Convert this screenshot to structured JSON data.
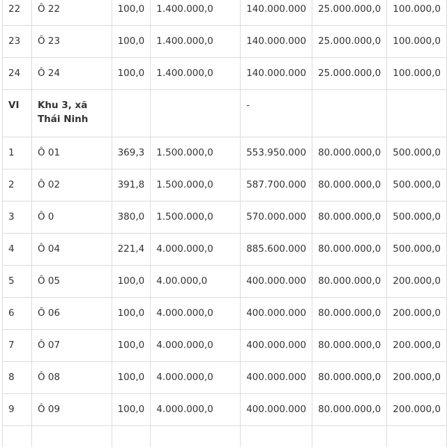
{
  "table": {
    "rows": [
      {
        "type": "row",
        "cells": [
          "22",
          "Ô 22",
          "100,0",
          "1.400.000,0",
          "140.000.000",
          "25.000.000,0",
          "100.000,0"
        ]
      },
      {
        "type": "row",
        "cells": [
          "23",
          "Ô 23",
          "100,0",
          "1.400.000,0",
          "140.000.000",
          "25.000.000,0",
          "100.000,0"
        ]
      },
      {
        "type": "row",
        "cells": [
          "24",
          "Ô 24",
          "100,0",
          "1.400.000,0",
          "140.000.000",
          "25.000.000,0",
          "100.000,0"
        ]
      },
      {
        "type": "section",
        "cells": [
          "VI",
          "Khu 3, xã Thái Ninh",
          "",
          "",
          "-",
          "",
          ""
        ]
      },
      {
        "type": "row",
        "cells": [
          "1",
          "Ô 01",
          "369,3",
          "1.500.000,0",
          "553.950.000",
          "80.000.000,0",
          "500.000,0"
        ]
      },
      {
        "type": "row",
        "cells": [
          "2",
          "Ô 02",
          "391,8",
          "1.500.000,0",
          "587.700.000",
          "80.000.000,0",
          "500.000,0"
        ]
      },
      {
        "type": "row",
        "cells": [
          "3",
          "Ô 0",
          "380,0",
          "1.500.000,0",
          "570.000.000",
          "80.000.000,0",
          "500.000,0"
        ]
      },
      {
        "type": "row",
        "cells": [
          "4",
          "Ô 04",
          "221,4",
          "4.000.000,0",
          "885.600.000",
          "80.000.000,0",
          "500.000,0"
        ]
      },
      {
        "type": "row",
        "cells": [
          "5",
          "Ô 05",
          "100,0",
          "4.00.000,0",
          "400.000.000",
          "80.000.000,0",
          "200.000,0"
        ]
      },
      {
        "type": "row",
        "cells": [
          "6",
          "Ô 06",
          "100,0",
          "4.000.000,0",
          "400.000.000",
          "80.000.000,0",
          "200.000,0"
        ]
      },
      {
        "type": "row",
        "cells": [
          "7",
          "Ô 07",
          "100,0",
          "4.000.000,0",
          "400.000.000",
          "80.000.000,0",
          "200.000,0"
        ]
      },
      {
        "type": "row",
        "cells": [
          "8",
          "Ô 08",
          "100,0",
          "4.000.000,0",
          "400.000.000",
          "80.000.000,0",
          "200.000,0"
        ]
      },
      {
        "type": "row",
        "cells": [
          "9",
          "Ô 09",
          "100,0",
          "4.000.000,0",
          "400.000.000",
          "80.000.000,0",
          "200.000,0"
        ]
      },
      {
        "type": "row",
        "cells": [
          "",
          "",
          "",
          "",
          "",
          "",
          ""
        ]
      }
    ]
  }
}
